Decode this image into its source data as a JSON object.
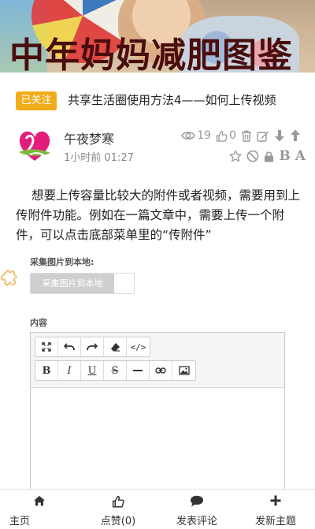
{
  "banner": {
    "title": "中年妈妈减肥图鉴"
  },
  "topic": {
    "badge": "已关注",
    "title": "共享生活圈使用方法4——如何上传视频"
  },
  "author": {
    "name": "午夜梦寒",
    "time": "1小时前 01:27"
  },
  "stats": {
    "views": "19",
    "likes": "0"
  },
  "post": {
    "body": "想要上传容量比较大的附件或者视频，需要用到上传附件功能。例如在一篇文章中，需要上传一个附件，可以点击底部菜单里的“传附件”"
  },
  "collect": {
    "label": "采集图片到本地:",
    "toggle_text": "采集图片到本地"
  },
  "content": {
    "label": "内容"
  },
  "editor": {
    "toolbar_row1": [
      "fullscreen-icon",
      "undo-icon",
      "redo-icon",
      "eraser-icon",
      "code-icon"
    ],
    "code_label": "</>",
    "bold": "B",
    "italic": "I",
    "underline": "U",
    "strike": "S"
  },
  "actions": {
    "font_big": "B",
    "font_small": "A"
  },
  "nav": {
    "home": "主页",
    "like": "点赞(0)",
    "comment": "发表评论",
    "new_topic": "发新主题"
  },
  "colors": {
    "badge": "#f0ad1b",
    "banner_title": "#4a0d0d",
    "icon_gray": "#999999"
  }
}
